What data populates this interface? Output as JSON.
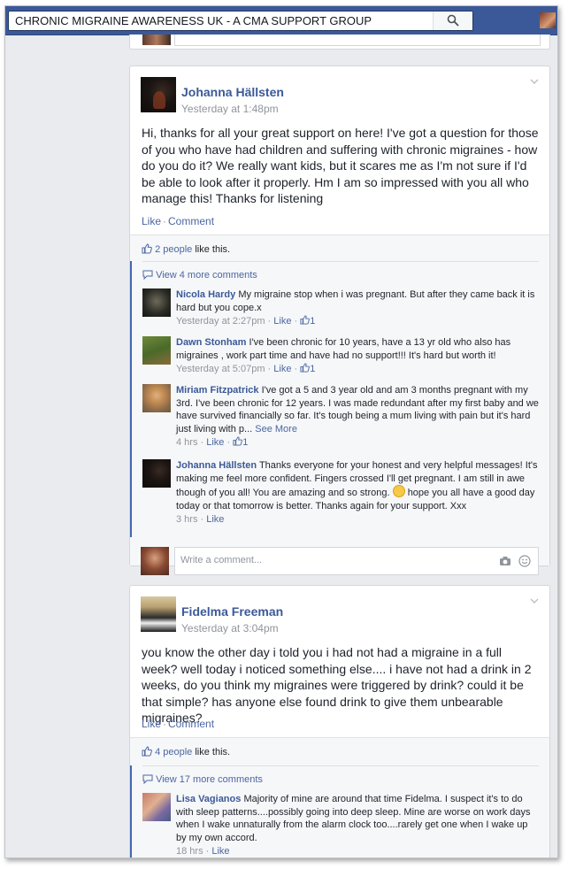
{
  "search": {
    "value": "CHRONIC MIGRAINE AWARENESS UK - A CMA SUPPORT GROUP"
  },
  "posts": [
    {
      "author": "Johanna Hällsten",
      "time": "Yesterday at 1:48pm",
      "text": "Hi, thanks for all your great support on here! I've got a question for those of you who have had children and suffering with chronic migraines - how do you do it? We really want kids, but it scares me as I'm not sure if I'd be able to look after it properly. Hm I am so impressed with you all who manage this! Thanks for listening",
      "actions": {
        "like": "Like",
        "comment": "Comment"
      },
      "likes": {
        "people": "2 people",
        "suffix": "like this."
      },
      "view_more": "View 4 more comments",
      "comments": [
        {
          "name": "Nicola Hardy",
          "text": "My migraine stop when i was pregnant. But after they came back it is hard but you cope.x",
          "time": "Yesterday at 2:27pm",
          "like": "Like",
          "like_count": "1"
        },
        {
          "name": "Dawn Stonham",
          "text": "I've been chronic for 10 years, have a 13 yr old who also has migraines , work part time and have had no support!!! It's hard but worth it!",
          "time": "Yesterday at 5:07pm",
          "like": "Like",
          "like_count": "1"
        },
        {
          "name": "Miriam Fitzpatrick",
          "text": "I've got a 5 and 3 year old and am 3 months pregnant with my 3rd. I've been chronic for 12 years. I was made redundant after my first baby and we have survived financially so far. It's tough being a mum living with pain but it's hard just living with p...",
          "see_more": "See More",
          "time": "4 hrs",
          "like": "Like",
          "like_count": "1"
        },
        {
          "name": "Johanna Hällsten",
          "text": "Thanks everyone for your honest and very helpful messages! It's making me feel more confident. Fingers crossed I'll get pregnant. I am still in awe though of you all! You are amazing and so strong.",
          "text2": "hope you all have a good day today or that tomorrow is better. Thanks again for your support. Xxx",
          "time": "3 hrs",
          "like": "Like"
        }
      ],
      "write_placeholder": "Write a comment..."
    },
    {
      "author": "Fidelma Freeman",
      "time": "Yesterday at 3:04pm",
      "text": "you know the other day i told you i had not had a migraine in a full week? well today i noticed something else.... i have not had a drink in 2 weeks, do you think my migraines were triggered by drink? could it be that simple? has anyone else found drink to give them unbearable migraines?",
      "actions": {
        "like": "Like",
        "comment": "Comment"
      },
      "likes": {
        "people": "4 people",
        "suffix": "like this."
      },
      "view_more": "View 17 more comments",
      "comments": [
        {
          "name": "Lisa Vagianos",
          "text": "Majority of mine are around that time Fidelma. I suspect it's to do with sleep patterns....possibly going into deep sleep. Mine are worse on work days when I wake unnaturally from the alarm clock too....rarely get one when I wake up by my own accord.",
          "time": "18 hrs",
          "like": "Like"
        }
      ]
    }
  ],
  "colors": {
    "brand": "#3b5998",
    "link": "#4b67a1",
    "meta": "#90949c",
    "accent_bar": "#4267b2"
  },
  "icons": [
    "search-icon",
    "chevron-down-icon",
    "thumbs-up-icon",
    "speech-bubble-icon",
    "camera-icon",
    "smiley-icon"
  ]
}
